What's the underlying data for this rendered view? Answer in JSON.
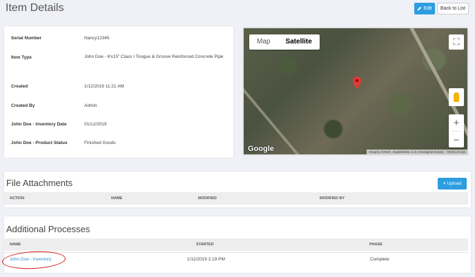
{
  "header": {
    "title": "Item Details",
    "edit_label": "Edit",
    "back_label": "Back to List"
  },
  "details": [
    {
      "label": "Serial Number",
      "value": "Nancy12345"
    },
    {
      "label": "Item Type",
      "value": "John Doe - 6'x15\" Class I Tongue & Groove Reinforced Concrete Pipe"
    },
    {
      "label": "Created",
      "value": "1/12/2019 11:21 AM"
    },
    {
      "label": "Created By",
      "value": "Admin"
    },
    {
      "label": "John Doe - Inventory Date",
      "value": "01/12/2019"
    },
    {
      "label": "John Doe - Product Status",
      "value": "Finished Goods"
    }
  ],
  "map": {
    "tab_map": "Map",
    "tab_satellite": "Satellite",
    "active_tab": "Satellite",
    "logo": "Google",
    "attribution": "Imagery ©2019 , DigitalGlobe, U.S. Geological Survey",
    "terms": "Terms of Use",
    "zoom_in": "+",
    "zoom_out": "−",
    "marker_color": "#e53935"
  },
  "files": {
    "title": "File Attachments",
    "upload_label": "Upload",
    "columns": [
      "ACTION",
      "NAME",
      "MODIFIED",
      "MODIFIED BY"
    ]
  },
  "processes": {
    "title": "Additional Processes",
    "columns": [
      "NAME",
      "STARTED",
      "PHASE"
    ],
    "rows": [
      {
        "name": "John Doe - Inventory",
        "started": "1/12/2019 2:19 PM",
        "phase": "Complete"
      }
    ]
  },
  "colors": {
    "accent": "#2d9de0",
    "link": "#2d8fd0",
    "annotation": "#d4161a"
  }
}
